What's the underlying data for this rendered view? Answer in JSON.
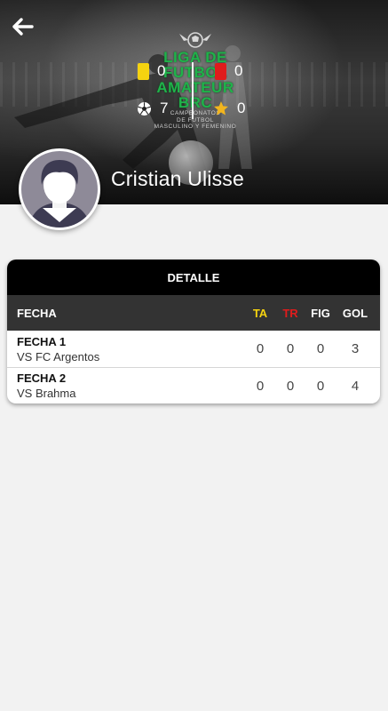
{
  "header": {
    "logo": {
      "lines": [
        "LIGA DE",
        "FUTBOL",
        "AMATEUR",
        "BRC"
      ],
      "sub": [
        "CAMPEONATOS",
        "DE FUTBOL",
        "MASCULINO Y FEMENINO"
      ]
    },
    "stats": {
      "yellow_cards": "0",
      "red_cards": "0",
      "goals": "7",
      "stars": "0"
    },
    "player_name": "Cristian Ulisse"
  },
  "detail": {
    "title": "DETALLE",
    "columns": {
      "fecha": "FECHA",
      "ta": "TA",
      "tr": "TR",
      "fig": "FIG",
      "gol": "GOL"
    },
    "rows": [
      {
        "fecha": "FECHA 1",
        "vs": "VS FC Argentos",
        "ta": "0",
        "tr": "0",
        "fig": "0",
        "gol": "3"
      },
      {
        "fecha": "FECHA 2",
        "vs": "VS Brahma",
        "ta": "0",
        "tr": "0",
        "fig": "0",
        "gol": "4"
      }
    ]
  },
  "colors": {
    "yellow_card": "#f5d310",
    "red_card": "#e01c1c",
    "logo_green": "#1fb34a",
    "header_black": "#000000",
    "table_head": "#333333"
  },
  "icons": {
    "back": "arrow-left-icon",
    "yellow_card": "yellow-card-icon",
    "red_card": "red-card-icon",
    "goals": "soccer-ball-icon",
    "figure": "star-icon",
    "avatar": "default-avatar-icon"
  }
}
